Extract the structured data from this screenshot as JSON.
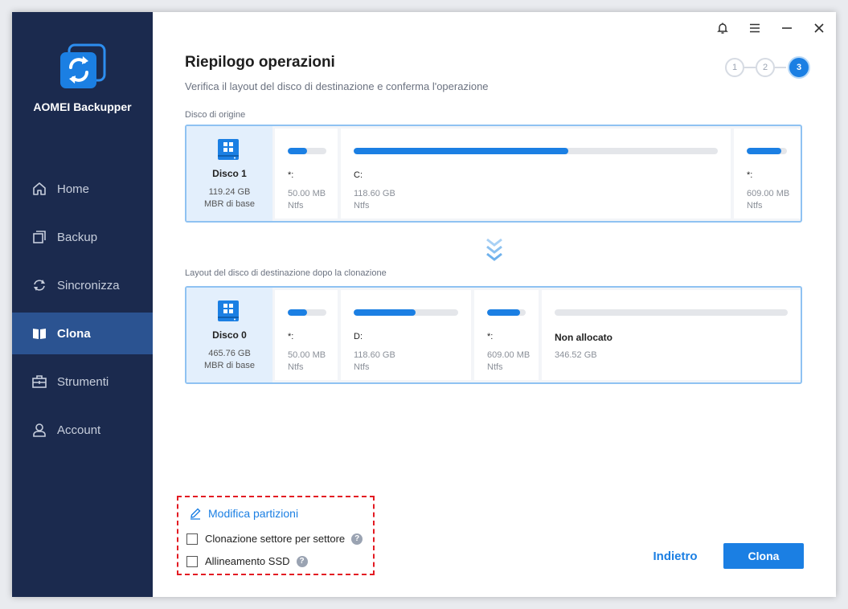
{
  "app": {
    "name": "AOMEI Backupper"
  },
  "sidebar": {
    "items": [
      {
        "label": "Home",
        "icon": "home-icon",
        "active": false
      },
      {
        "label": "Backup",
        "icon": "backup-icon",
        "active": false
      },
      {
        "label": "Sincronizza",
        "icon": "sync-icon",
        "active": false
      },
      {
        "label": "Clona",
        "icon": "clone-icon",
        "active": true
      },
      {
        "label": "Strumenti",
        "icon": "tools-icon",
        "active": false
      },
      {
        "label": "Account",
        "icon": "account-icon",
        "active": false
      }
    ]
  },
  "titlebar": {
    "icons": [
      "bell-icon",
      "menu-icon",
      "minimize-icon",
      "close-icon"
    ]
  },
  "page": {
    "title": "Riepilogo operazioni",
    "subtitle": "Verifica il layout del disco di destinazione e conferma l'operazione",
    "steps": [
      "1",
      "2",
      "3"
    ],
    "active_step": 3
  },
  "source": {
    "label": "Disco di origine",
    "disk": {
      "name": "Disco 1",
      "size": "119.24 GB",
      "type": "MBR di base"
    },
    "partitions": [
      {
        "letter": "*:",
        "size": "50.00 MB",
        "fs": "Ntfs",
        "used_fraction": 0.5
      },
      {
        "letter": "C:",
        "size": "118.60 GB",
        "fs": "Ntfs",
        "used_fraction": 0.59
      },
      {
        "letter": "*:",
        "size": "609.00 MB",
        "fs": "Ntfs",
        "used_fraction": 0.86
      }
    ]
  },
  "destination": {
    "label": "Layout del disco di destinazione dopo la clonazione",
    "disk": {
      "name": "Disco 0",
      "size": "465.76 GB",
      "type": "MBR di base"
    },
    "partitions": [
      {
        "letter": "*:",
        "size": "50.00 MB",
        "fs": "Ntfs",
        "used_fraction": 0.5
      },
      {
        "letter": "D:",
        "size": "118.60 GB",
        "fs": "Ntfs",
        "used_fraction": 0.59
      },
      {
        "letter": "*:",
        "size": "609.00 MB",
        "fs": "Ntfs",
        "used_fraction": 0.86
      },
      {
        "letter": "Non allocato",
        "size": "346.52 GB",
        "fs": "",
        "used_fraction": 0
      }
    ]
  },
  "options": {
    "edit_label": "Modifica partizioni",
    "sector_clone_label": "Clonazione settore per settore",
    "ssd_align_label": "Allineamento SSD",
    "help_glyph": "?"
  },
  "buttons": {
    "back": "Indietro",
    "clone": "Clona"
  },
  "colors": {
    "accent": "#1b7fe3",
    "sidebar": "#1b2a4e",
    "sidebar_active": "#2b5391"
  }
}
